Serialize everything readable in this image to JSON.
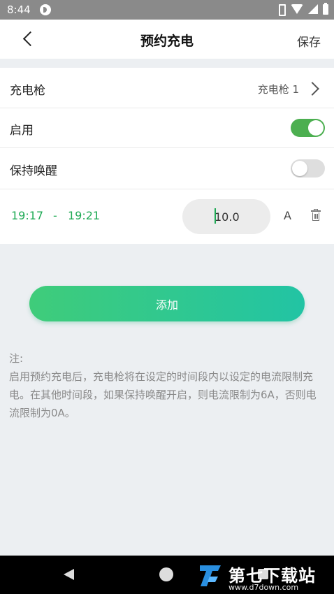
{
  "status_bar": {
    "time": "8:44"
  },
  "header": {
    "title": "预约充电",
    "save_label": "保存"
  },
  "settings": {
    "gun_label": "充电枪",
    "gun_value": "充电枪 1",
    "enable_label": "启用",
    "enable_on": true,
    "keep_awake_label": "保持唤醒",
    "keep_awake_on": false
  },
  "schedule": {
    "start": "19:17",
    "separator": "-",
    "end": "19:21",
    "current": "10.0",
    "unit": "A"
  },
  "add_label": "添加",
  "note": {
    "title": "注:",
    "body": "启用预约充电后，充电枪将在设定的时间段内以设定的电流限制充电。在其他时间段，如果保持唤醒开启，则电流限制为6A，否则电流限制为0A。"
  },
  "watermark": {
    "title": "第七下载站",
    "url": "www.d7down.com"
  },
  "colors": {
    "accent": "#4caf50",
    "time_text": "#1faa55",
    "button_start": "#3fcc7a",
    "button_end": "#22c4a4"
  }
}
